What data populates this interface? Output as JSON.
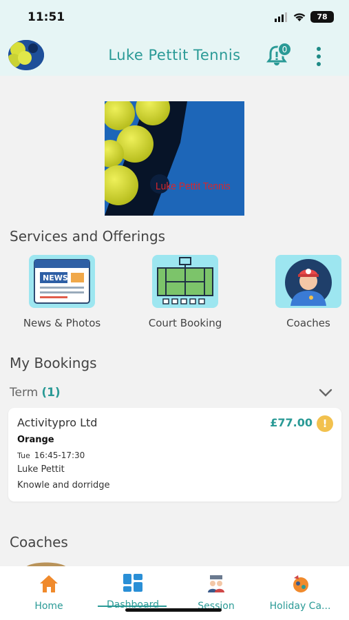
{
  "status": {
    "time": "11:51",
    "battery": "78"
  },
  "header": {
    "title": "Luke Pettit Tennis",
    "notifications_count": "0"
  },
  "banner": {
    "text": "Luke Pettit Tennis"
  },
  "services": {
    "title": "Services and Offerings",
    "items": [
      {
        "label": "News & Photos",
        "icon": "news-icon"
      },
      {
        "label": "Court Booking",
        "icon": "tennis-court-icon"
      },
      {
        "label": "Coaches",
        "icon": "coach-icon"
      }
    ]
  },
  "bookings": {
    "title": "My Bookings",
    "term_label": "Term",
    "term_count": "(1)",
    "card": {
      "provider": "Activitypro Ltd",
      "price": "£77.00",
      "alert": "!",
      "group": "Orange",
      "day": "Tue",
      "time": "16:45-17:30",
      "coach": "Luke Pettit",
      "venue": "Knowle and dorridge"
    }
  },
  "coaches": {
    "title": "Coaches"
  },
  "nav": {
    "items": [
      {
        "label": "Home",
        "icon": "home-icon"
      },
      {
        "label": "Dashboard",
        "icon": "dashboard-icon"
      },
      {
        "label": "Session",
        "icon": "session-icon"
      },
      {
        "label": "Holiday Ca...",
        "icon": "holiday-camp-icon"
      }
    ]
  },
  "colors": {
    "accent": "#2a9a96",
    "header_bg": "#e6f5f5",
    "service_tile": "#9de6f0",
    "warning": "#f2c14e"
  }
}
